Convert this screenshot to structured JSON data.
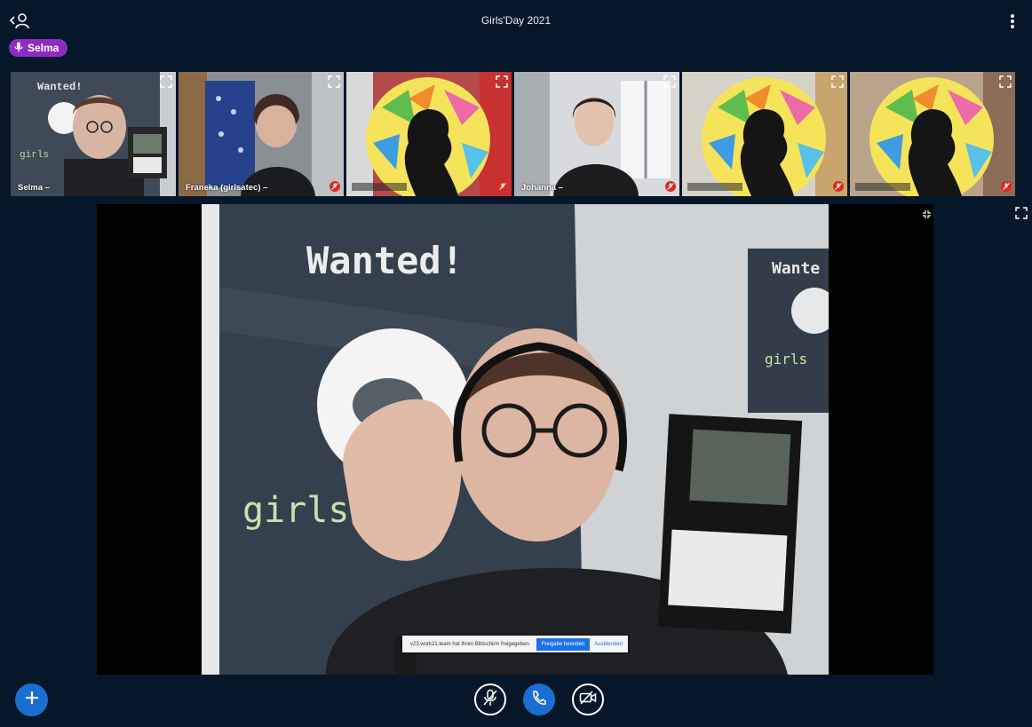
{
  "header": {
    "title": "Girls'Day 2021",
    "user_list_icon": "user-list-icon",
    "menu_icon": "vertical-dots-icon"
  },
  "talker": {
    "name": "Selma",
    "color": "#8e2bc1",
    "icon": "microphone-icon"
  },
  "participants": [
    {
      "label": "Selma –",
      "active": true,
      "muted": false,
      "avatar": "webcam"
    },
    {
      "label": "Franeka (girlsatec) –",
      "active": false,
      "muted": true,
      "avatar": "webcam"
    },
    {
      "label": "",
      "active": false,
      "muted": true,
      "avatar": "girls-day-logo"
    },
    {
      "label": "Johanna –",
      "active": false,
      "muted": true,
      "avatar": "webcam"
    },
    {
      "label": "",
      "active": false,
      "muted": true,
      "avatar": "girls-day-logo"
    },
    {
      "label": "",
      "active": false,
      "muted": true,
      "avatar": "girls-day-logo"
    }
  ],
  "main_video": {
    "poster_word": "Wanted!",
    "poster_word_2": "girls",
    "small_poster_word": "Wante",
    "small_poster_word_2": "girls"
  },
  "screen_share_bar": {
    "message": "v23.work21.team hat Ihren Bildschirm freigegeben.",
    "stop_label": "Freigabe beenden",
    "hide_label": "Ausblenden"
  },
  "controls": {
    "plus_icon": "plus-icon",
    "mic_icon": "mic-muted-icon",
    "call_icon": "phone-icon",
    "camera_icon": "camera-off-icon",
    "accent": "#1b6ed1"
  }
}
